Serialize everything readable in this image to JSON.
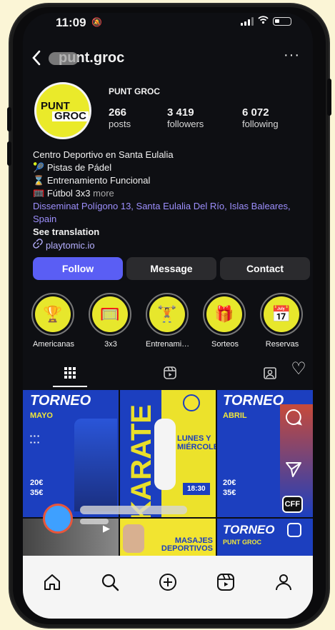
{
  "status": {
    "time": "11:09"
  },
  "header": {
    "handle": "punt.groc"
  },
  "profile": {
    "name": "PUNT GROC",
    "avatar_line1": "PUNT",
    "avatar_line2": "GROC",
    "stats": [
      {
        "value": "266",
        "label": "posts"
      },
      {
        "value": "3 419",
        "label": "followers"
      },
      {
        "value": "6 072",
        "label": "following"
      }
    ],
    "bio": {
      "line1": "Centro Deportivo en Santa Eulalia",
      "line2": "Pistas de Pádel",
      "line3": "Entrenamiento Funcional",
      "line4": "Fútbol 3x3",
      "more": "more",
      "address": "Disseminat Polígono 13, Santa Eulalia Del Río, Islas Baleares, Spain",
      "translation": "See translation",
      "link": "playtomic.io"
    }
  },
  "buttons": {
    "follow": "Follow",
    "message": "Message",
    "contact": "Contact"
  },
  "highlights": [
    {
      "label": "Americanas",
      "icon": "trophy-icon"
    },
    {
      "label": "3x3",
      "icon": "goal-icon"
    },
    {
      "label": "Entrenamie...",
      "icon": "dumbbell-icon"
    },
    {
      "label": "Sorteos",
      "icon": "gift-icon"
    },
    {
      "label": "Reservas",
      "icon": "calendar-icon"
    }
  ],
  "posts": {
    "p1_title": "TORNEO",
    "p1_sub": "MAYO",
    "p1_price1": "20€",
    "p1_price2": "35€",
    "p2_title": "KARATE",
    "p2_sub1": "LUNES Y",
    "p2_sub2": "MIÉRCOLES",
    "p2_time": "18:30",
    "p3_title": "TORNEO",
    "p3_sub": "ABRIL",
    "p3_price1": "20€",
    "p3_price2": "35€",
    "p4_title": "MASAJES",
    "p4_title2": "DEPORTIVOS",
    "p5_title": "TORNEO",
    "p5_sub": "PUNT GROC"
  },
  "colors": {
    "accent": "#5a5ef4",
    "brand_yellow": "#e9df2a",
    "post_blue": "#1c3fbf"
  }
}
